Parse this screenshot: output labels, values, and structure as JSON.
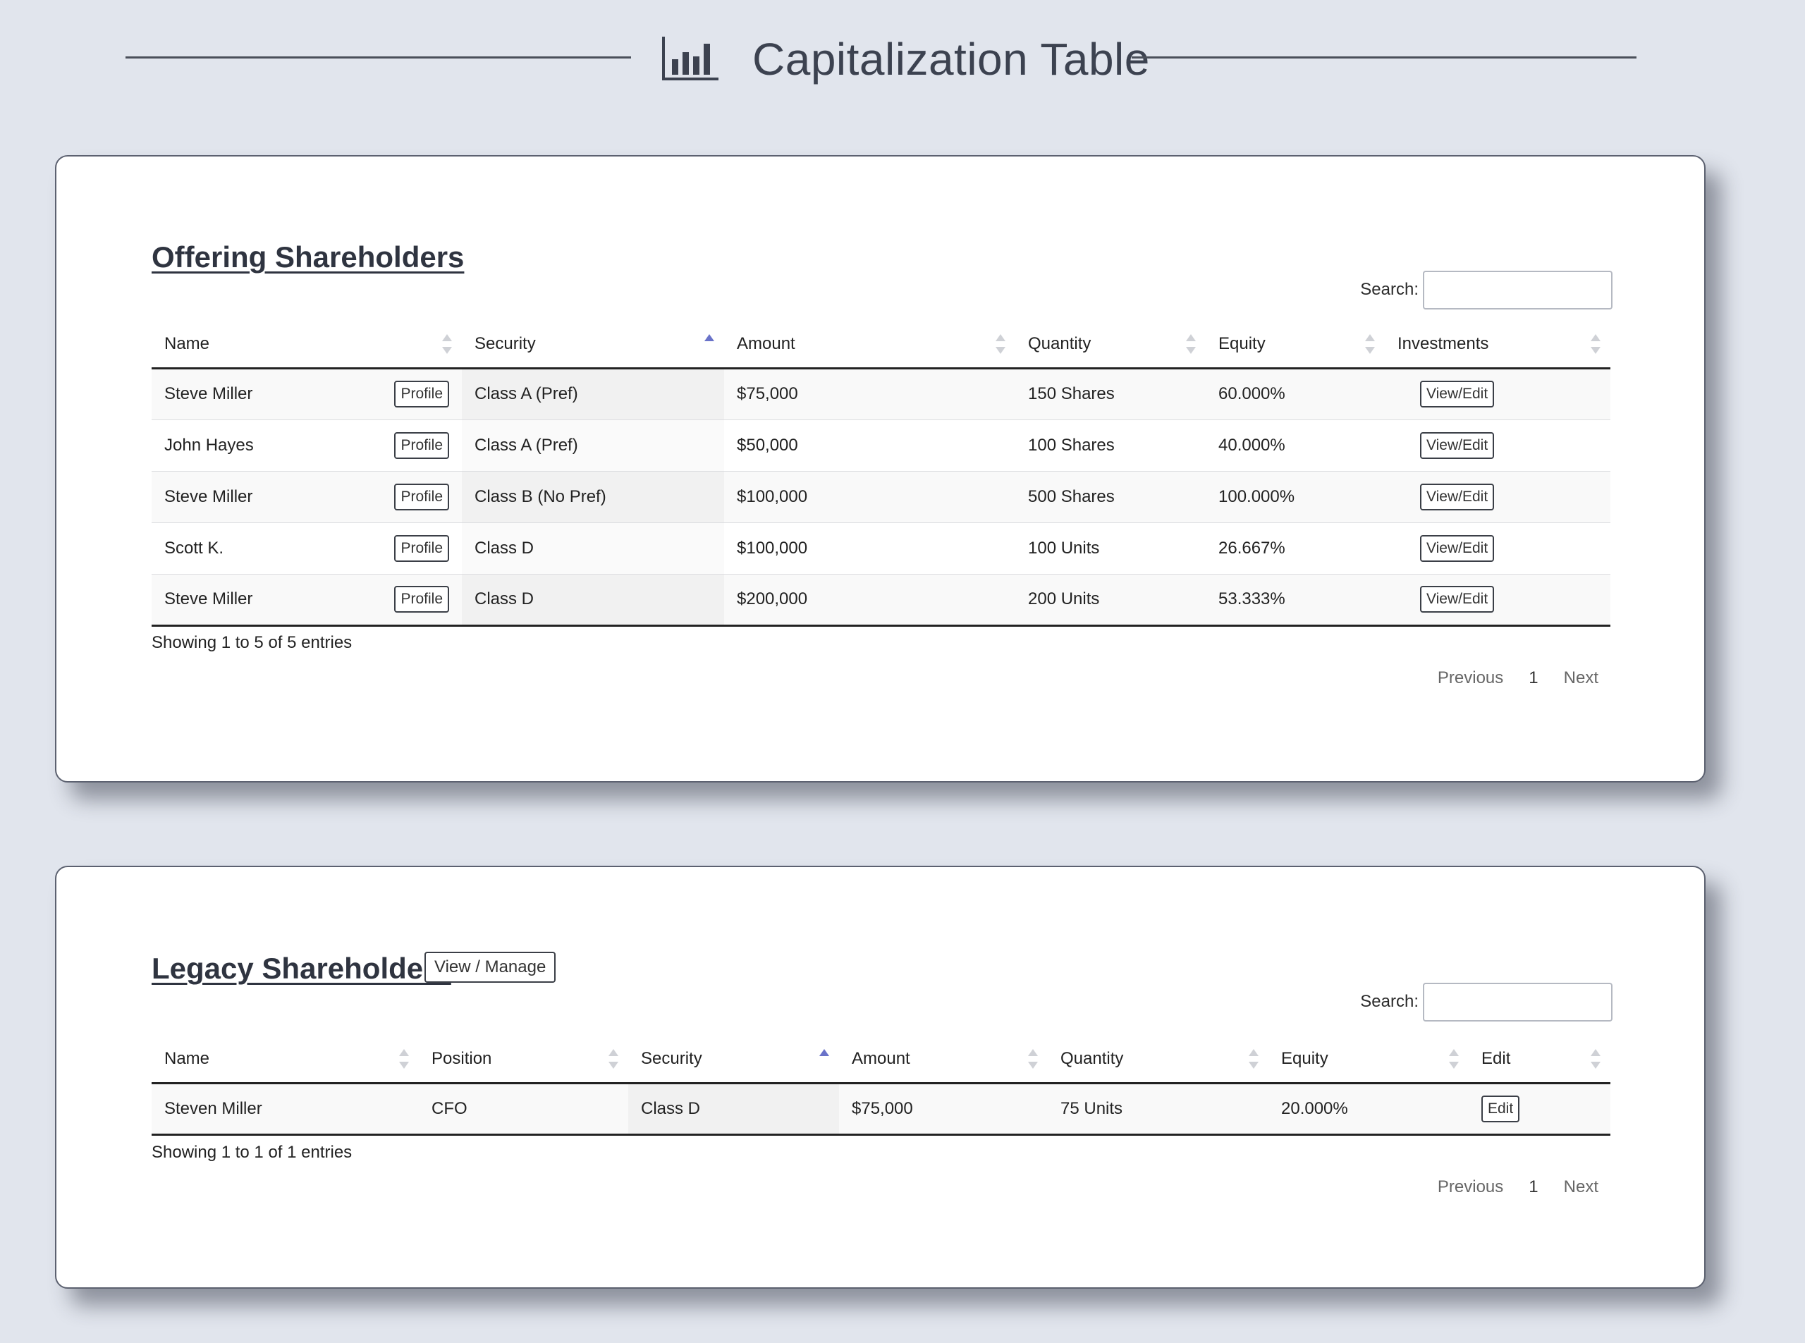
{
  "header": {
    "title": "Capitalization Table",
    "icon": "bar-chart-icon"
  },
  "search_label": "Search:",
  "offering": {
    "title": "Offering Shareholders",
    "columns": [
      "Name",
      "Security",
      "Amount",
      "Quantity",
      "Equity",
      "Investments"
    ],
    "rows": [
      {
        "name": "Steve Miller",
        "profile": "Profile",
        "security": "Class A (Pref)",
        "amount": "$75,000",
        "quantity": "150 Shares",
        "equity": "60.000%",
        "action": "View/Edit"
      },
      {
        "name": "John Hayes",
        "profile": "Profile",
        "security": "Class A (Pref)",
        "amount": "$50,000",
        "quantity": "100 Shares",
        "equity": "40.000%",
        "action": "View/Edit"
      },
      {
        "name": "Steve Miller",
        "profile": "Profile",
        "security": "Class B (No Pref)",
        "amount": "$100,000",
        "quantity": "500 Shares",
        "equity": "100.000%",
        "action": "View/Edit"
      },
      {
        "name": "Scott K.",
        "profile": "Profile",
        "security": "Class D",
        "amount": "$100,000",
        "quantity": "100 Units",
        "equity": "26.667%",
        "action": "View/Edit"
      },
      {
        "name": "Steve Miller",
        "profile": "Profile",
        "security": "Class D",
        "amount": "$200,000",
        "quantity": "200 Units",
        "equity": "53.333%",
        "action": "View/Edit"
      }
    ],
    "info": "Showing 1 to 5 of 5 entries",
    "pager": {
      "previous": "Previous",
      "page": "1",
      "next": "Next"
    }
  },
  "legacy": {
    "title": "Legacy Shareholders",
    "manage_label": "View / Manage",
    "columns": [
      "Name",
      "Position",
      "Security",
      "Amount",
      "Quantity",
      "Equity",
      "Edit"
    ],
    "rows": [
      {
        "name": "Steven Miller",
        "position": "CFO",
        "security": "Class D",
        "amount": "$75,000",
        "quantity": "75 Units",
        "equity": "20.000%",
        "action": "Edit"
      }
    ],
    "info": "Showing 1 to 1 of 1 entries",
    "pager": {
      "previous": "Previous",
      "page": "1",
      "next": "Next"
    }
  },
  "colors": {
    "sort_active": "#6a73c9",
    "sort_inactive": "#cfd1d6",
    "background": "#e1e5ed"
  }
}
